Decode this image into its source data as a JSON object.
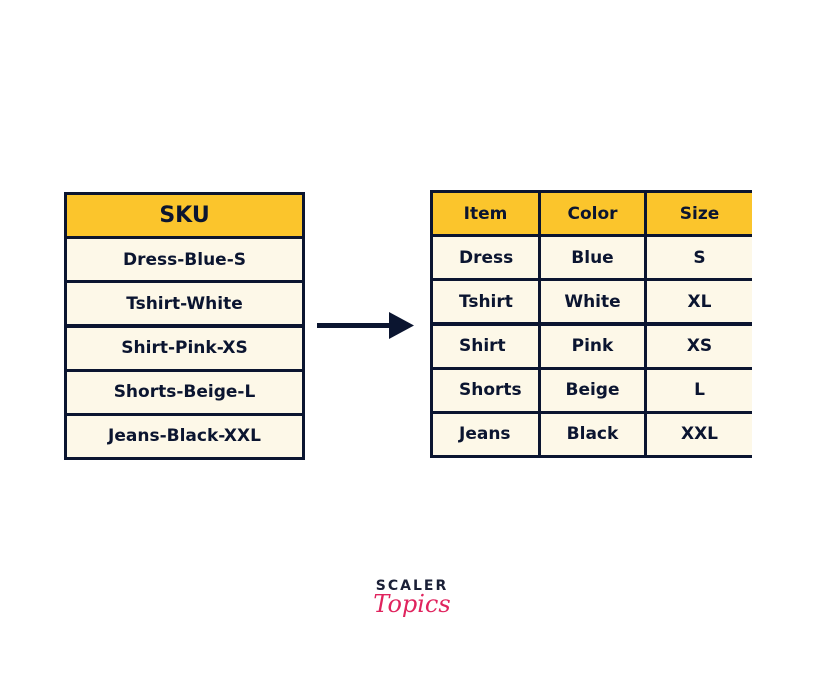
{
  "sku_table": {
    "header": "SKU",
    "rows": [
      "Dress-Blue-S",
      "Tshirt-White",
      "Shirt-Pink-XS",
      "Shorts-Beige-L",
      "Jeans-Black-XXL"
    ]
  },
  "split_table": {
    "headers": [
      "Item",
      "Color",
      "Size"
    ],
    "rows": [
      [
        "Dress",
        "Blue",
        "S"
      ],
      [
        "Tshirt",
        "White",
        "XL"
      ],
      [
        "Shirt",
        "Pink",
        "XS"
      ],
      [
        "Shorts",
        "Beige",
        "L"
      ],
      [
        "Jeans",
        "Black",
        "XXL"
      ]
    ]
  },
  "arrow": {
    "icon": "arrow-right-icon"
  },
  "logo": {
    "brand": "SCALER",
    "product": "Topics"
  },
  "colors": {
    "header": "#fbc52c",
    "cell": "#fdf8e8",
    "border": "#0b1530",
    "logo_accent": "#e0245e"
  }
}
